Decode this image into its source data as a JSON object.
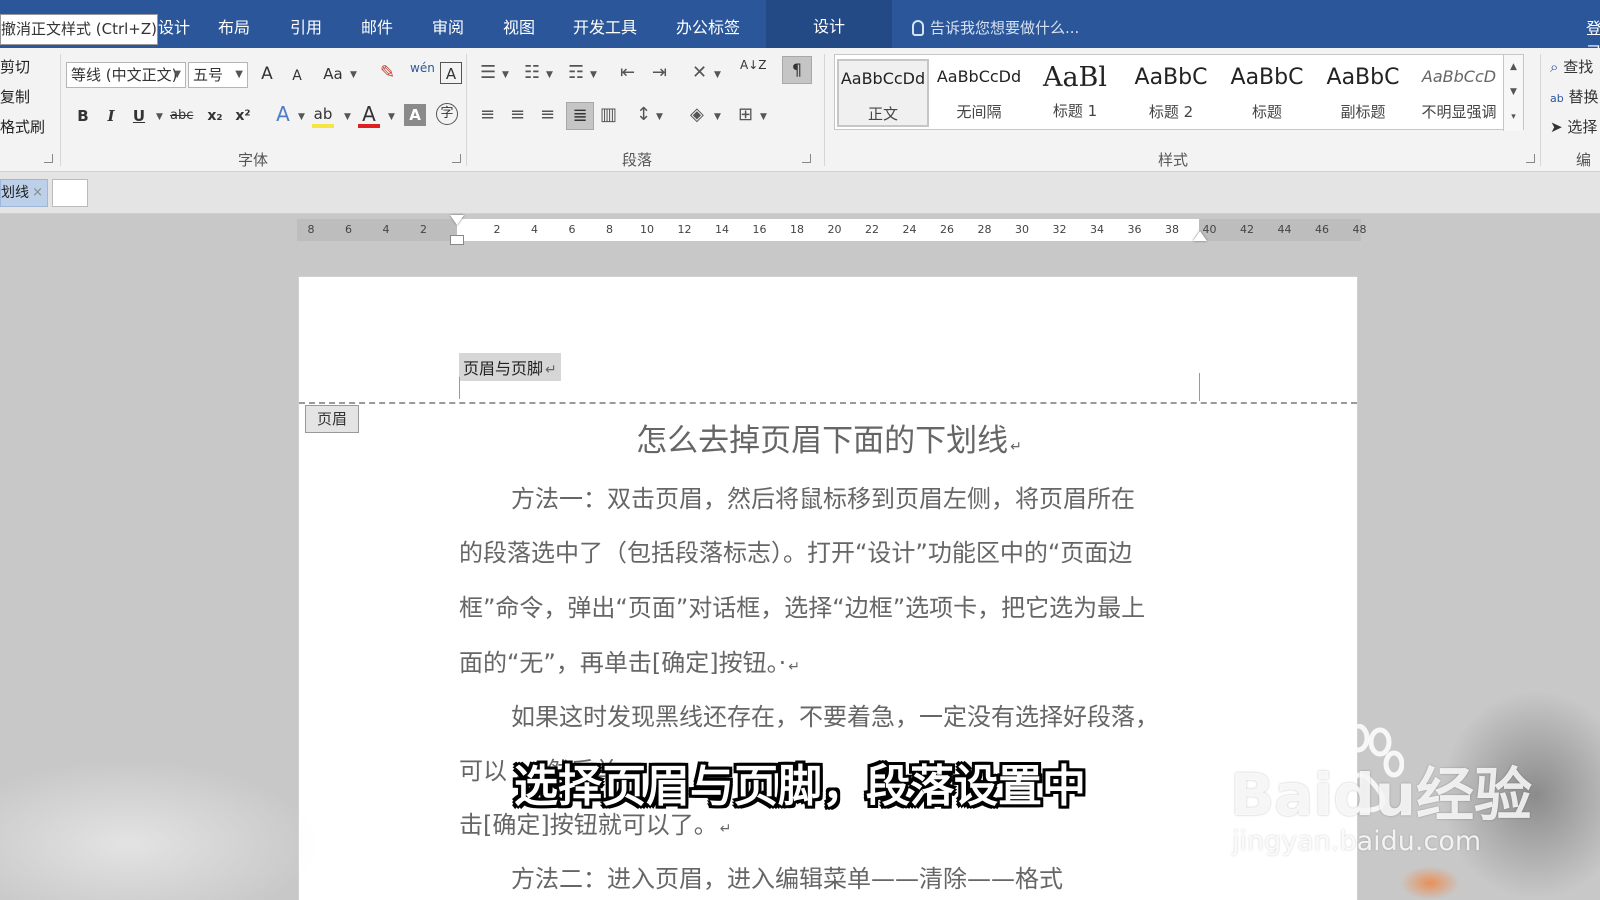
{
  "menubar": {
    "tooltip": "撤消正文样式 (Ctrl+Z)",
    "tabs": [
      "设计",
      "布局",
      "引用",
      "邮件",
      "审阅",
      "视图",
      "开发工具",
      "办公标签"
    ],
    "context_tab": "设计",
    "tell_me": "告诉我您想要做什么...",
    "login": "登录"
  },
  "clipboard": {
    "cut": "剪切",
    "copy": "复制",
    "format_painter": "格式刷"
  },
  "font": {
    "group_label": "字体",
    "font_name": "等线 (中文正文)",
    "font_size": "五号",
    "grow": "A",
    "shrink": "A",
    "change_case": "Aa",
    "phonetic": "wén",
    "char_border": "A",
    "bold": "B",
    "italic": "I",
    "underline": "U",
    "strikethrough": "abc",
    "subscript": "x₂",
    "superscript": "x²",
    "text_effect": "A",
    "highlight": "ab",
    "font_color": "A",
    "char_shading": "A",
    "enclose": "字"
  },
  "paragraph": {
    "group_label": "段落",
    "sort": "A↓Z"
  },
  "styles": {
    "group_label": "样式",
    "items": [
      {
        "sample": "AaBbCcDd",
        "name": "正文"
      },
      {
        "sample": "AaBbCcDd",
        "name": "无间隔"
      },
      {
        "sample": "AaBl",
        "name": "标题 1"
      },
      {
        "sample": "AaBbC",
        "name": "标题 2"
      },
      {
        "sample": "AaBbC",
        "name": "标题"
      },
      {
        "sample": "AaBbC",
        "name": "副标题"
      },
      {
        "sample": "AaBbCcD",
        "name": "不明显强调"
      }
    ]
  },
  "editing": {
    "group_label": "编辑",
    "find": "查找",
    "replace": "替换",
    "select": "选择"
  },
  "doc_tab": {
    "label": "划线",
    "close": "×"
  },
  "ruler": {
    "labels": [
      "8",
      "6",
      "4",
      "2",
      "2",
      "4",
      "6",
      "8",
      "10",
      "12",
      "14",
      "16",
      "18",
      "20",
      "22",
      "24",
      "26",
      "28",
      "30",
      "32",
      "34",
      "36",
      "38",
      "40",
      "42",
      "44",
      "46",
      "48"
    ]
  },
  "document": {
    "header_text": "页眉与页脚",
    "header_tag": "页眉",
    "title": "怎么去掉页眉下面的下划线",
    "paragraphs": [
      "方法一：双击页眉，然后将鼠标移到页眉左侧，将页眉所在",
      "的段落选中了（包括段落标志）。打开“设计”功能区中的“页面边",
      "框”命令，弹出“页面”对话框，选择“边框”选项卡，把它选为最上",
      "面的“无”，再单击[确定]按钮。·",
      "如果这时发现黑线还存在，不要着急，一定没有选择好段落，",
      "可以 … 然后单",
      "击[确定]按钮就可以了。",
      "方法二：进入页眉，进入编辑菜单——清除——格式"
    ],
    "para_mark": "↵"
  },
  "overlay": {
    "subtitle": "选择页眉与页脚，段落设置中",
    "watermark_logo": "Baidu经验",
    "watermark_url": "jingyan.baidu.com"
  },
  "colors": {
    "menubar": "#2b579a",
    "ribbon": "#f3f3f3",
    "workspace": "#c8c8c8"
  }
}
